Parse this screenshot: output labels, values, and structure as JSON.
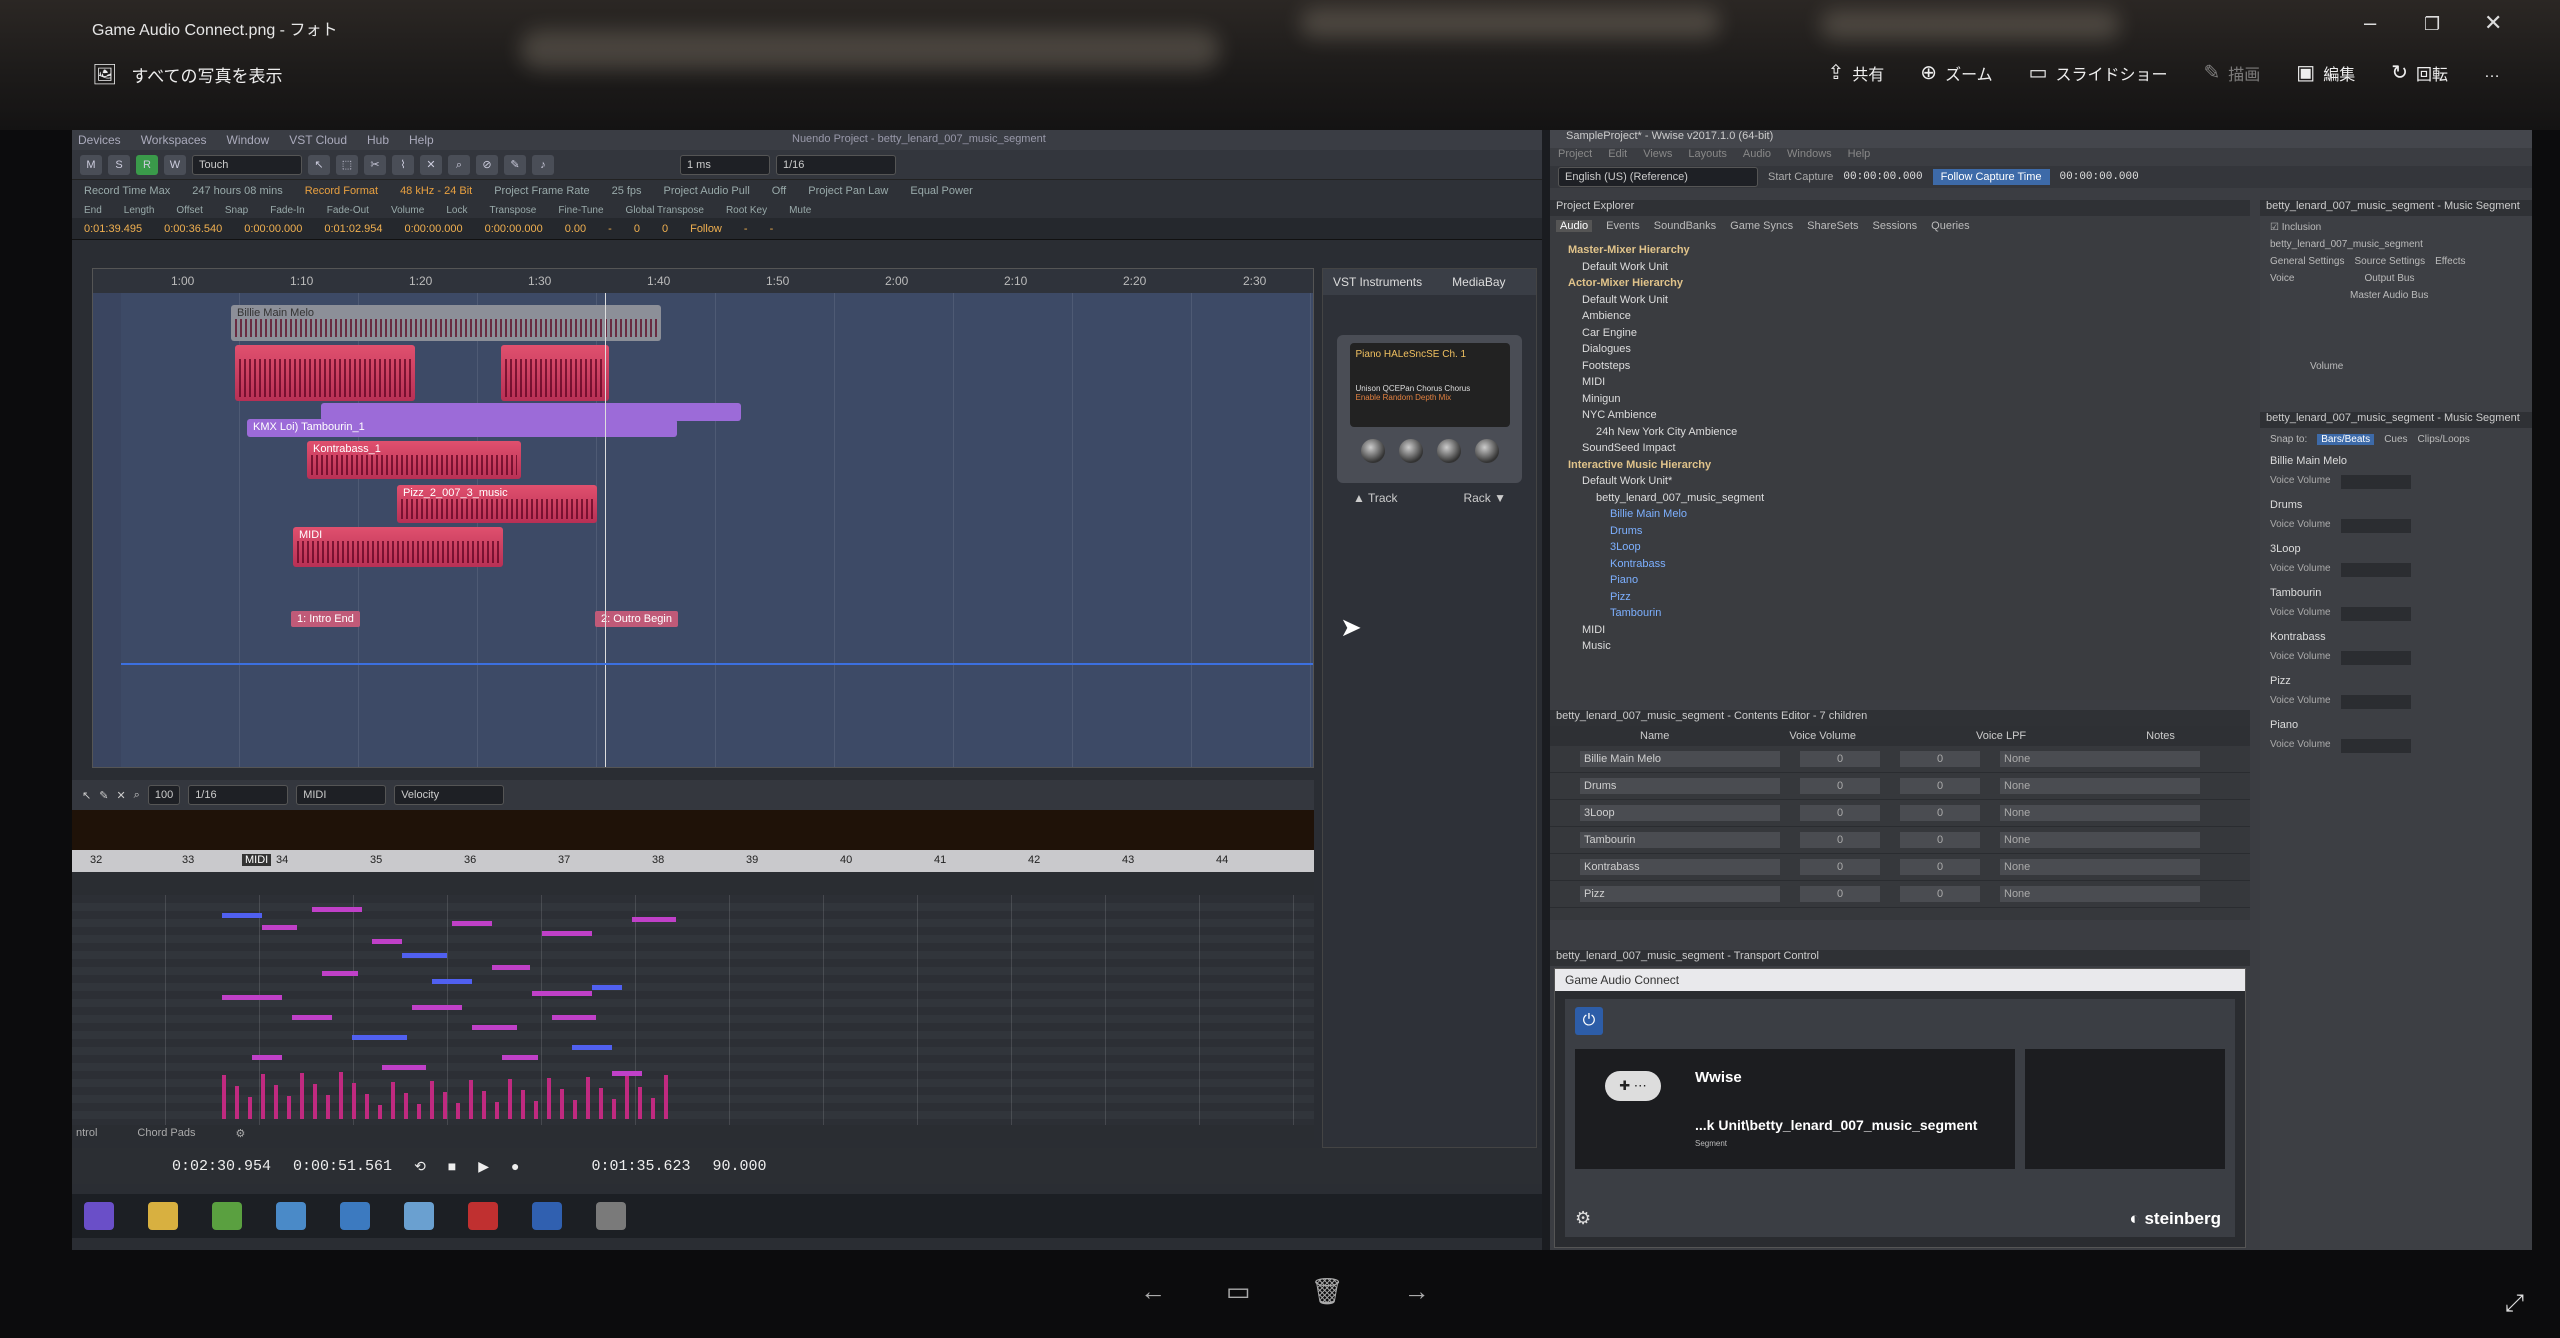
{
  "viewer": {
    "title": "Game Audio Connect.png - フォト",
    "show_all": "すべての写真を表示",
    "share": "共有",
    "zoom": "ズーム",
    "slideshow": "スライドショー",
    "draw": "描画",
    "edit": "編集",
    "rotate": "回転",
    "more": "…"
  },
  "nuendo": {
    "title": "Nuendo Project - betty_lenard_007_music_segment",
    "menu": [
      "Devices",
      "Workspaces",
      "Window",
      "VST Cloud",
      "Hub",
      "Help"
    ],
    "touch": "Touch",
    "quant": "1/16",
    "nudge": "1 ms",
    "info_labels": [
      "Record Time Max",
      "247 hours 08 mins",
      "Record Format",
      "48 kHz - 24 Bit",
      "Project Frame Rate",
      "25 fps",
      "Project Audio Pull",
      "Off",
      "Project Pan Law",
      "Equal Power"
    ],
    "info_heads": [
      "End",
      "Length",
      "Offset",
      "Snap",
      "Fade-In",
      "Fade-Out",
      "Volume",
      "Lock",
      "Transpose",
      "Fine-Tune",
      "Global Transpose",
      "Root Key",
      "Mute"
    ],
    "info_vals": [
      "0:01:39.495",
      "0:00:36.540",
      "0:00:00.000",
      "0:01:02.954",
      "0:00:00.000",
      "0:00:00.000",
      "0.00",
      "-",
      "0",
      "0",
      "Follow",
      "-",
      "-"
    ],
    "ruler": [
      "1:00",
      "1:10",
      "1:20",
      "1:30",
      "1:40",
      "1:50",
      "2:00",
      "2:10",
      "2:20",
      "2:30"
    ],
    "clips": {
      "billie": "Billie Main Melo",
      "tambourin": "KMX Loi) Tambourin_1",
      "kontrabass": "Kontrabass_1",
      "pizz": "Pizz_2_007_3_music",
      "midi": "MIDI"
    },
    "markers": [
      "1: Intro End",
      "2: Outro Begin"
    ],
    "vst_tab": "VST Instruments",
    "media_tab": "MediaBay",
    "instrument": "Piano HALeSncSE Ch. 1",
    "inst_params": "Unison QCEPan Chorus Chorus",
    "inst_params2": "Enable Random Depth Mix",
    "track": "Track",
    "rack": "Rack",
    "editor_zoom": "100",
    "editor_quant": "1/16",
    "editor_midi": "MIDI",
    "editor_velocity": "Velocity",
    "bar_numbers": [
      "32",
      "33",
      "34",
      "35",
      "36",
      "37",
      "38",
      "39",
      "40",
      "41",
      "42",
      "43",
      "44"
    ],
    "bar_midi": "MIDI",
    "editor_footer_left": "ntrol",
    "editor_footer_chord": "Chord Pads",
    "time_left": "0:02:30.954",
    "time_right": "0:00:51.561",
    "time_main": "0:01:35.623",
    "tempo": "90.000"
  },
  "wwise": {
    "title": "SampleProject* - Wwise v2017.1.0 (64-bit)",
    "menu": [
      "Project",
      "Edit",
      "Views",
      "Layouts",
      "Audio",
      "Windows",
      "Help"
    ],
    "language": "English (US) (Reference)",
    "start_capture": "Start Capture",
    "tc1": "00:00:00.000",
    "follow": "Follow Capture Time",
    "tc2": "00:00:00.000",
    "explorer_title": "Project Explorer",
    "explorer_tabs": [
      "Audio",
      "Events",
      "SoundBanks",
      "Game Syncs",
      "ShareSets",
      "Sessions",
      "Queries"
    ],
    "tree": [
      {
        "text": "Master-Mixer Hierarchy",
        "cls": "hdr",
        "indent": 0
      },
      {
        "text": "Default Work Unit",
        "cls": "",
        "indent": 1
      },
      {
        "text": "Actor-Mixer Hierarchy",
        "cls": "hdr",
        "indent": 0
      },
      {
        "text": "Default Work Unit",
        "cls": "",
        "indent": 1
      },
      {
        "text": "Ambience",
        "cls": "",
        "indent": 1
      },
      {
        "text": "Car Engine",
        "cls": "",
        "indent": 1
      },
      {
        "text": "Dialogues",
        "cls": "",
        "indent": 1
      },
      {
        "text": "Footsteps",
        "cls": "",
        "indent": 1
      },
      {
        "text": "MIDI",
        "cls": "",
        "indent": 1
      },
      {
        "text": "Minigun",
        "cls": "",
        "indent": 1
      },
      {
        "text": "NYC Ambience",
        "cls": "",
        "indent": 1
      },
      {
        "text": "24h New York City Ambience",
        "cls": "",
        "indent": 2
      },
      {
        "text": "SoundSeed Impact",
        "cls": "",
        "indent": 1
      },
      {
        "text": "Interactive Music Hierarchy",
        "cls": "hdr",
        "indent": 0
      },
      {
        "text": "Default Work Unit*",
        "cls": "",
        "indent": 1
      },
      {
        "text": "betty_lenard_007_music_segment",
        "cls": "",
        "indent": 2
      },
      {
        "text": "Billie Main Melo",
        "cls": "blue",
        "indent": 3
      },
      {
        "text": "Drums",
        "cls": "blue",
        "indent": 3
      },
      {
        "text": "3Loop",
        "cls": "blue",
        "indent": 3
      },
      {
        "text": "Kontrabass",
        "cls": "blue",
        "indent": 3
      },
      {
        "text": "Piano",
        "cls": "blue",
        "indent": 3
      },
      {
        "text": "Pizz",
        "cls": "blue",
        "indent": 3
      },
      {
        "text": "Tambourin",
        "cls": "blue",
        "indent": 3
      },
      {
        "text": "MIDI",
        "cls": "",
        "indent": 1
      },
      {
        "text": "Music",
        "cls": "",
        "indent": 1
      }
    ],
    "contents_title": "betty_lenard_007_music_segment - Contents Editor - 7 children",
    "contents_head": [
      "Name",
      "Voice Volume",
      "Voice LPF",
      "Notes"
    ],
    "contents_rows": [
      {
        "name": "Billie Main Melo",
        "vol": "0",
        "lpf": "0",
        "notes": "None"
      },
      {
        "name": "Drums",
        "vol": "0",
        "lpf": "0",
        "notes": "None"
      },
      {
        "name": "3Loop",
        "vol": "0",
        "lpf": "0",
        "notes": "None"
      },
      {
        "name": "Tambourin",
        "vol": "0",
        "lpf": "0",
        "notes": "None"
      },
      {
        "name": "Kontrabass",
        "vol": "0",
        "lpf": "0",
        "notes": "None"
      },
      {
        "name": "Pizz",
        "vol": "0",
        "lpf": "0",
        "notes": "None"
      }
    ],
    "transport_title": "betty_lenard_007_music_segment - Transport Control",
    "gac_title": "Game Audio Connect",
    "gac_app": "Wwise",
    "gac_path": "...k Unit\\betty_lenard_007_music_segment",
    "gac_sub": "Segment",
    "gac_brand": "steinberg",
    "props_title": "betty_lenard_007_music_segment - Music Segment",
    "props_inclusion": "Inclusion",
    "props_name": "betty_lenard_007_music_segment",
    "props_tabs": [
      "General Settings",
      "Source Settings",
      "Effects"
    ],
    "voice": "Voice",
    "output_bus": "Output Bus",
    "master_bus": "Master Audio Bus",
    "volume": "Volume",
    "segment_title": "betty_lenard_007_music_segment - Music Segment",
    "snap_to": "Snap to:",
    "snap_mode": "Bars/Beats",
    "cues": "Cues",
    "clips_loops": "Clips/Loops",
    "seg_tracks": [
      "Billie Main Melo",
      "Drums",
      "3Loop",
      "Tambourin",
      "Kontrabass",
      "Pizz",
      "Piano"
    ],
    "voice_volume": "Voice Volume"
  }
}
